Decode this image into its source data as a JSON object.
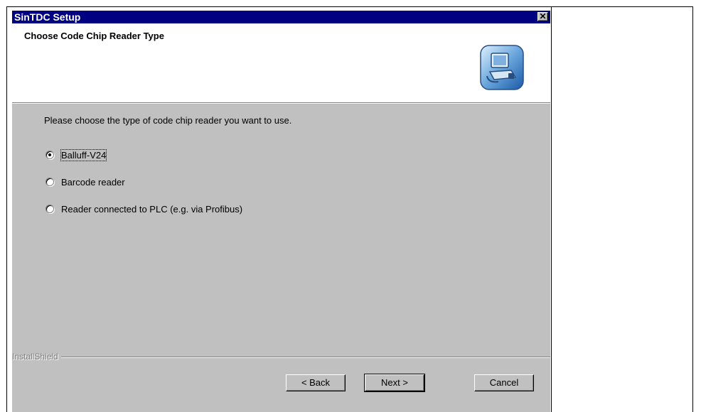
{
  "window": {
    "title": "SinTDC Setup",
    "close_label": "✕"
  },
  "header": {
    "title": "Choose Code Chip Reader Type",
    "icon": "computer-setup-icon"
  },
  "main": {
    "instruction": "Please choose the type of code chip reader you want to use.",
    "options": [
      {
        "label": "Balluff-V24",
        "selected": true
      },
      {
        "label": "Barcode reader",
        "selected": false
      },
      {
        "label": "Reader connected to PLC (e.g. via Profibus)",
        "selected": false
      }
    ]
  },
  "footer": {
    "brand": "InstallShield",
    "back_label": "< Back",
    "next_label": "Next >",
    "cancel_label": "Cancel"
  },
  "colors": {
    "titlebar": "#000080",
    "dialog_face": "#c0c0c0",
    "header_bg": "#ffffff"
  }
}
